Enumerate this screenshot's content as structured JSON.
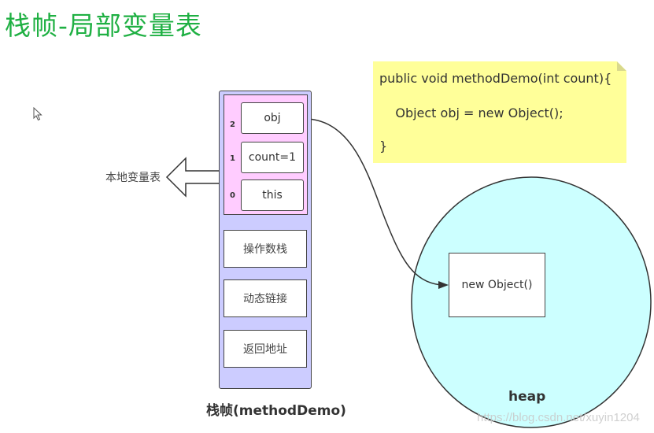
{
  "title": "栈帧-局部变量表",
  "stack_frame": {
    "label": "栈帧(methodDemo)",
    "local_variable_table": {
      "label": "本地变量表",
      "slots": [
        {
          "index": "2",
          "value": "obj"
        },
        {
          "index": "1",
          "value": "count=1"
        },
        {
          "index": "0",
          "value": "this"
        }
      ]
    },
    "parts": [
      "操作数栈",
      "动态链接",
      "返回地址"
    ]
  },
  "code_note": {
    "lines": [
      "public void methodDemo(int count){",
      "    Object obj = new Object();",
      "}"
    ]
  },
  "heap": {
    "label": "heap",
    "object_label": "new Object()"
  },
  "colors": {
    "title": "#1fb043",
    "frame_fill": "#ccccff",
    "local_table_fill": "#ffccff",
    "note_fill": "#ffff99",
    "heap_fill": "#ccffff"
  },
  "watermark": "https://blog.csdn.net/xuyin1204"
}
